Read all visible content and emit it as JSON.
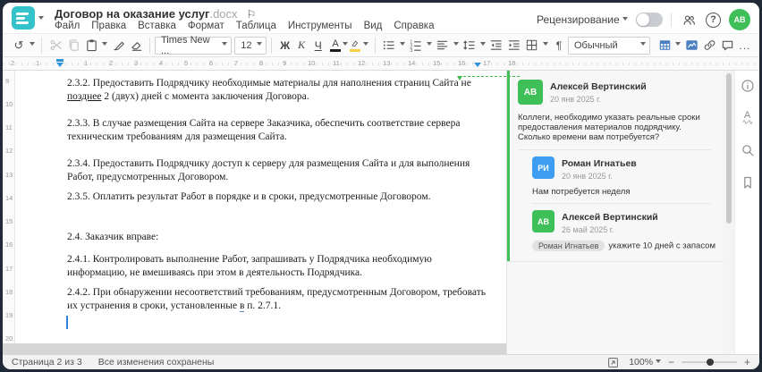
{
  "header": {
    "title": "Договор на оказание услуг",
    "title_ext": ".docx",
    "flag_glyph": "⚐",
    "menu_items": [
      "Файл",
      "Правка",
      "Вставка",
      "Формат",
      "Таблица",
      "Инструменты",
      "Вид",
      "Справка"
    ],
    "review_label": "Рецензирование",
    "help_glyph": "?",
    "avatar_initials": "АВ"
  },
  "toolbar": {
    "undo_glyph": "↺",
    "font_name": "Times New ...",
    "font_size": "12",
    "bold": "Ж",
    "italic": "К",
    "underline": "Ч",
    "font_color": "А",
    "pilcrow": "¶",
    "style_name": "Обычный",
    "more": "..."
  },
  "ruler": {
    "h": [
      "2",
      "1",
      "1",
      "2",
      "3",
      "4",
      "5",
      "6",
      "7",
      "8",
      "9",
      "10",
      "11",
      "12",
      "13",
      "14",
      "15",
      "16",
      "17",
      "18"
    ],
    "v": [
      "9",
      "10",
      "11",
      "12",
      "13",
      "14",
      "15",
      "16",
      "17",
      "18",
      "19",
      "20"
    ]
  },
  "document": {
    "lines": {
      "l1": "2.3.2. Предоставить Подрядчику необходимые материалы для наполнения страниц Сайта не",
      "l2_underlined": "позднее",
      "l2_rest": " 2 (двух) дней с момента заключения Договора.",
      "l3": "2.3.3. В случае размещения Сайта на сервере Заказчика, обеспечить соответствие сервера",
      "l4": "техническим требованиям для размещения Сайта.",
      "l5": "2.3.4. Предоставить Подрядчику доступ к серверу для размещения Сайта и для выполнения",
      "l6": "Работ, предусмотренных Договором.",
      "l7": "2.3.5. Оплатить результат Работ в порядке и в сроки, предусмотренные Договором.",
      "l8": "2.4. Заказчик вправе:",
      "l9": "2.4.1. Контролировать выполнение Работ, запрашивать у Подрядчика необходимую",
      "l10": "информацию, не вмешиваясь при этом в деятельность Подрядчика.",
      "l11": "2.4.2. При обнаружении несоответствий требованиям, предусмотренным Договором, требовать",
      "l12_pre": "их устранения в сроки, установленные ",
      "l12_marked": "в",
      "l12_post": " п. 2.7.1."
    }
  },
  "comments": {
    "c1": {
      "initials": "АВ",
      "author": "Алексей Вертинский",
      "date": "20 янв 2025 г.",
      "text": "Коллеги, необходимо указать реальные сроки предоставления материалов подрядчику. Сколько времени вам потребуется?"
    },
    "c2": {
      "initials": "РИ",
      "author": "Роман Игнатьев",
      "date": "20 янв 2025 г.",
      "text": "Нам потребуется неделя"
    },
    "c3": {
      "initials": "АВ",
      "author": "Алексей Вертинский",
      "date": "26 май 2025 г.",
      "mention": "Роман Игнатьев",
      "text": "укажите 10 дней с запасом"
    }
  },
  "statusbar": {
    "page_info": "Страница 2 из 3",
    "save_status": "Все изменения сохранены",
    "zoom_value": "100%",
    "minus": "−",
    "plus": "+"
  },
  "colors": {
    "accent_teal": "#35c3cb",
    "comment_green": "#3fbf58",
    "comment_blue": "#3d9df3",
    "ruler_marker_blue": "#2f93d9",
    "toolbar_icon_blue": "#4a7fc1"
  }
}
